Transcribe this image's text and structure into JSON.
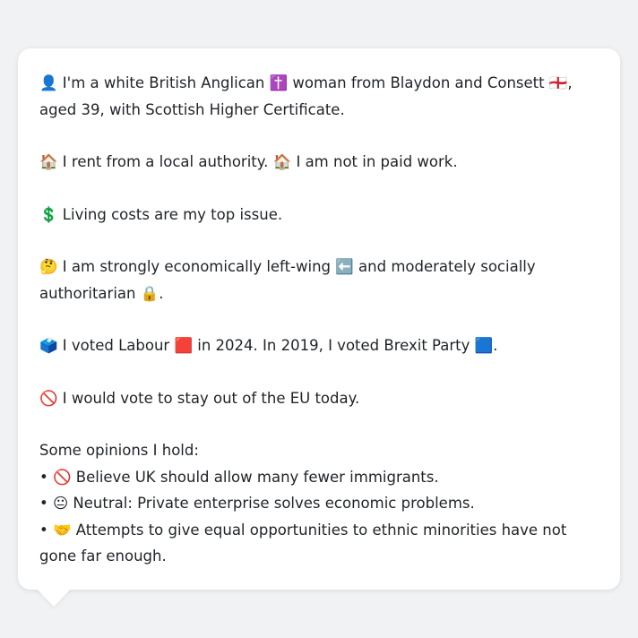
{
  "intro": {
    "p1": "👤 I'm a white British Anglican ✝️ woman from Blaydon and Consett 🏴󠁧󠁢󠁥󠁮󠁧󠁿, aged 39, with Scottish Higher Certificate.",
    "p2": "🏠 I rent from a local authority. 🏠 I am not in paid work.",
    "p3": "💲 Living costs are my top issue.",
    "p4": "🤔 I am strongly economically left-wing ⬅️ and moderately socially authoritarian 🔒.",
    "p5": "🗳️ I voted Labour 🟥 in 2024. In 2019, I voted Brexit Party 🟦.",
    "p6": "🚫 I would vote to stay out of the EU today."
  },
  "opinions": {
    "heading": "Some opinions I hold:",
    "items": [
      "• 🚫 Believe UK should allow many fewer immigrants.",
      "• 😐 Neutral: Private enterprise solves economic problems.",
      "• 🤝 Attempts to give equal opportunities to ethnic minorities have not gone far enough."
    ]
  }
}
